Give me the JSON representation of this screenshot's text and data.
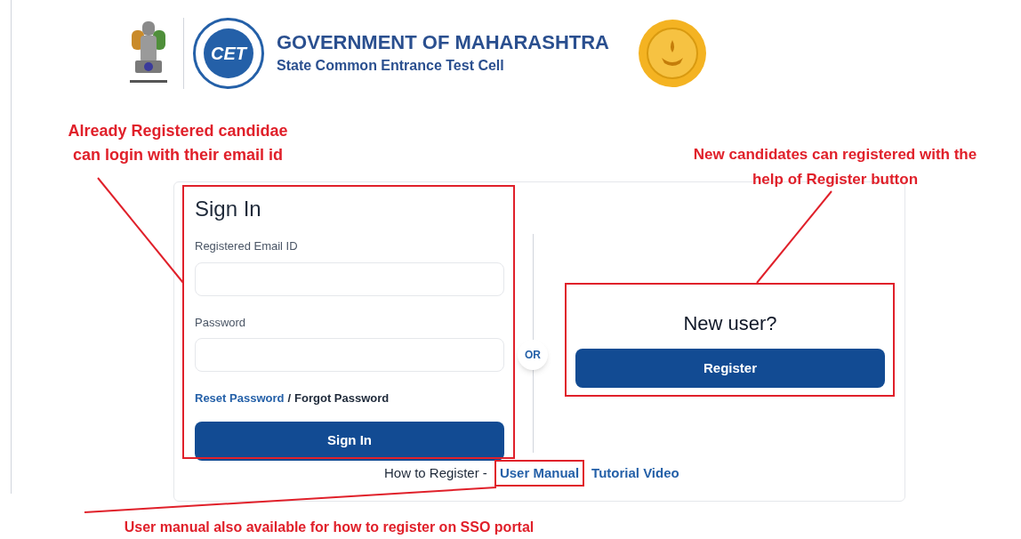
{
  "header": {
    "logo_text": "CET",
    "title": "GOVERNMENT OF MAHARASHTRA",
    "subtitle": "State Common Entrance Test Cell"
  },
  "sign_in": {
    "heading": "Sign In",
    "email_label": "Registered Email ID",
    "password_label": "Password",
    "reset_link": "Reset Password",
    "separator": "/",
    "forgot_text": "Forgot Password",
    "button": "Sign In"
  },
  "divider_label": "OR",
  "new_user": {
    "heading": "New user?",
    "button": "Register"
  },
  "footer": {
    "prefix": "How to Register -",
    "links": [
      "User Manual",
      "Tutorial Video"
    ]
  },
  "annotations": [
    {
      "lines": [
        "Already Registered candidae",
        "can login with their email id"
      ]
    },
    {
      "lines": [
        "New candidates can registered with the",
        "help of Register button"
      ]
    },
    {
      "lines": [
        "User manual also available for how to register on SSO portal"
      ]
    }
  ]
}
